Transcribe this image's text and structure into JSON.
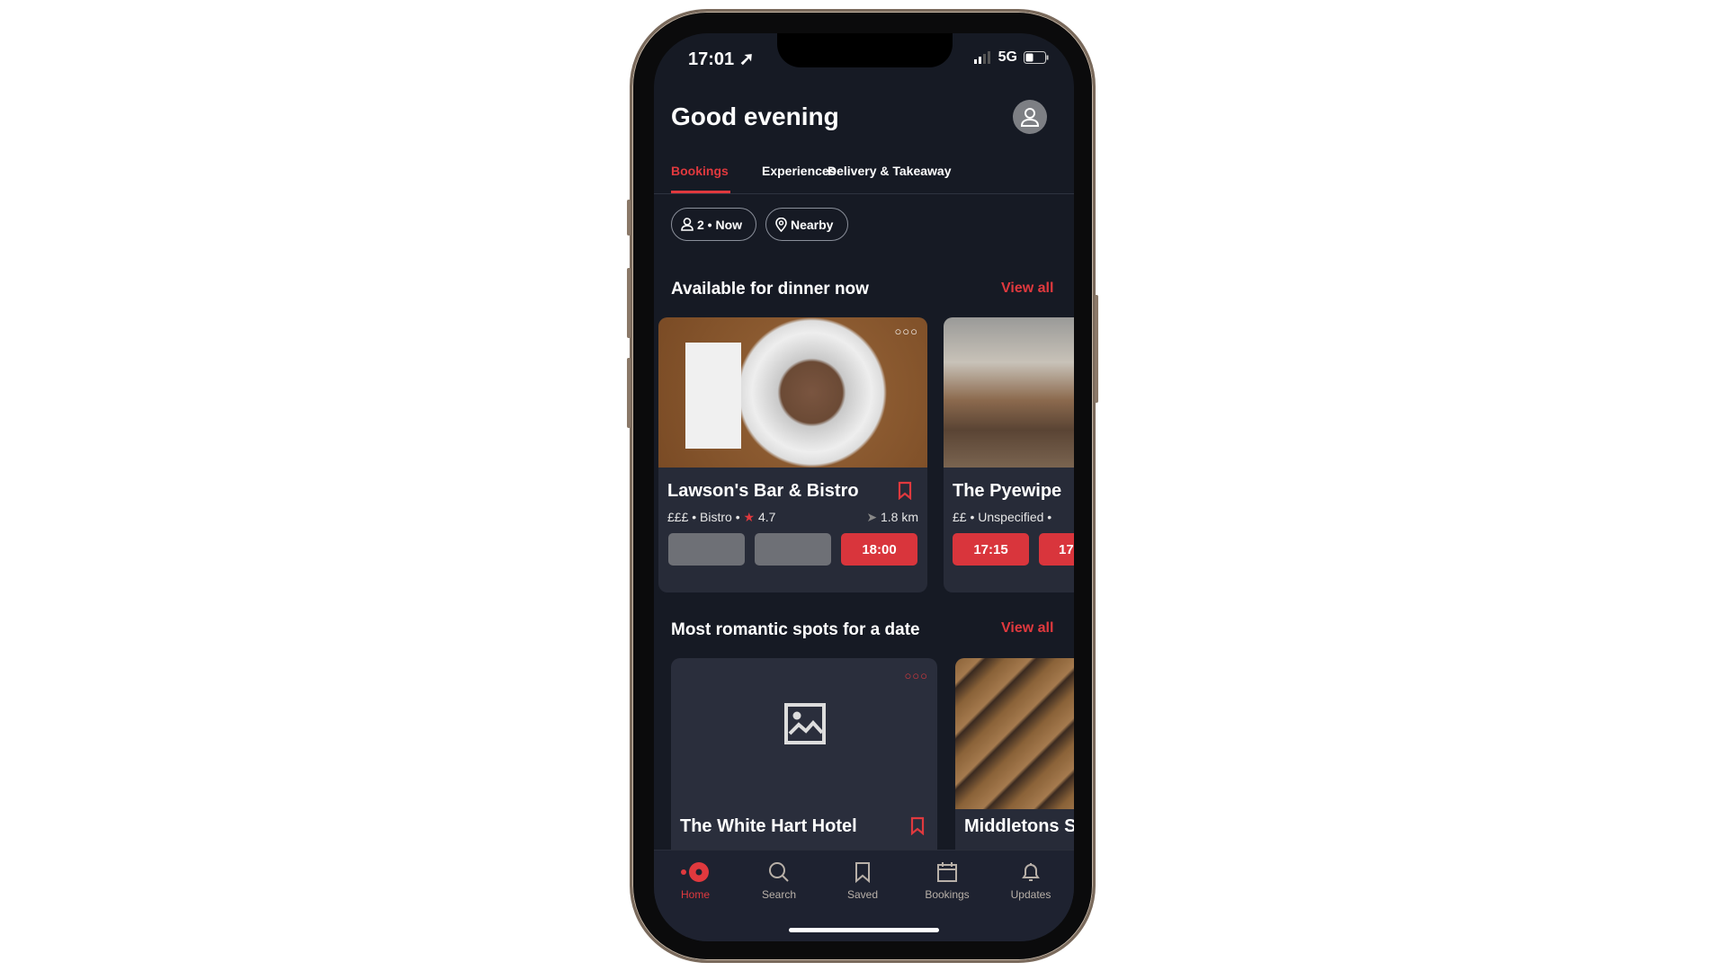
{
  "status": {
    "time": "17:01",
    "network": "5G",
    "battery_percent": 35
  },
  "header": {
    "title": "Good evening"
  },
  "tabs": [
    {
      "label": "Bookings",
      "active": true
    },
    {
      "label": "Experiences"
    },
    {
      "label": "Delivery & Takeaway"
    }
  ],
  "filters": {
    "party": "2 • Now",
    "location": "Nearby"
  },
  "sections": [
    {
      "title": "Available for dinner now",
      "view_all": "View all",
      "cards": [
        {
          "name": "Lawson's Bar & Bistro",
          "price": "£££",
          "cuisine": "Bistro",
          "rating": "4.7",
          "distance": "1.8 km",
          "slots": [
            "",
            "",
            "18:00"
          ]
        },
        {
          "name": "The Pyewipe",
          "price": "££",
          "cuisine": "Unspecified",
          "slots": [
            "17:15",
            "17"
          ]
        }
      ]
    },
    {
      "title": "Most romantic spots for a date",
      "view_all": "View all",
      "cards": [
        {
          "name": "The White Hart Hotel"
        },
        {
          "name": "Middletons S"
        }
      ]
    }
  ],
  "nav": [
    {
      "label": "Home",
      "active": true
    },
    {
      "label": "Search"
    },
    {
      "label": "Saved"
    },
    {
      "label": "Bookings"
    },
    {
      "label": "Updates"
    }
  ],
  "colors": {
    "accent": "#e0393e",
    "background": "#161a24",
    "card": "#272b38"
  }
}
